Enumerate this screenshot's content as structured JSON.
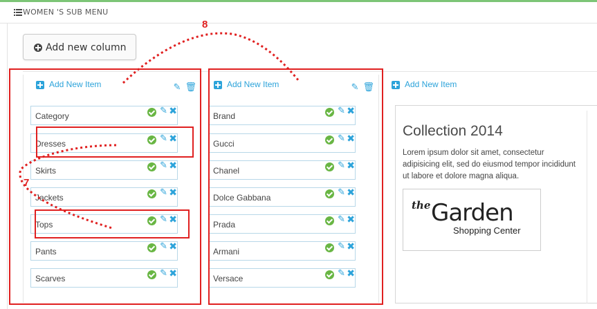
{
  "header": {
    "title": "WOMEN 'S SUB MENU",
    "icon": "list-icon"
  },
  "add_column_label": "Add new column",
  "columns": [
    {
      "add_label": "Add New Item",
      "items": [
        "Category",
        "Dresses",
        "Skirts",
        "Jackets",
        "Tops",
        "Pants",
        "Scarves"
      ]
    },
    {
      "add_label": "Add New Item",
      "items": [
        "Brand",
        "Gucci",
        "Chanel",
        "Dolce Gabbana",
        "Prada",
        "Armani",
        "Versace"
      ]
    },
    {
      "add_label": "Add New Item",
      "items": []
    }
  ],
  "collection": {
    "title": "Collection 2014",
    "text": "Lorem ipsum dolor sit amet, consectetur adipisicing elit, sed do eiusmod tempor incididunt ut labore et dolore magna aliqua.",
    "logo": {
      "the": "the",
      "garden": "Garden",
      "sub": "Shopping Center"
    }
  },
  "annotations": {
    "label_7": "7",
    "label_8": "8"
  },
  "colors": {
    "accent": "#2ca3da",
    "ok": "#69b644",
    "annotation": "#e02020"
  }
}
